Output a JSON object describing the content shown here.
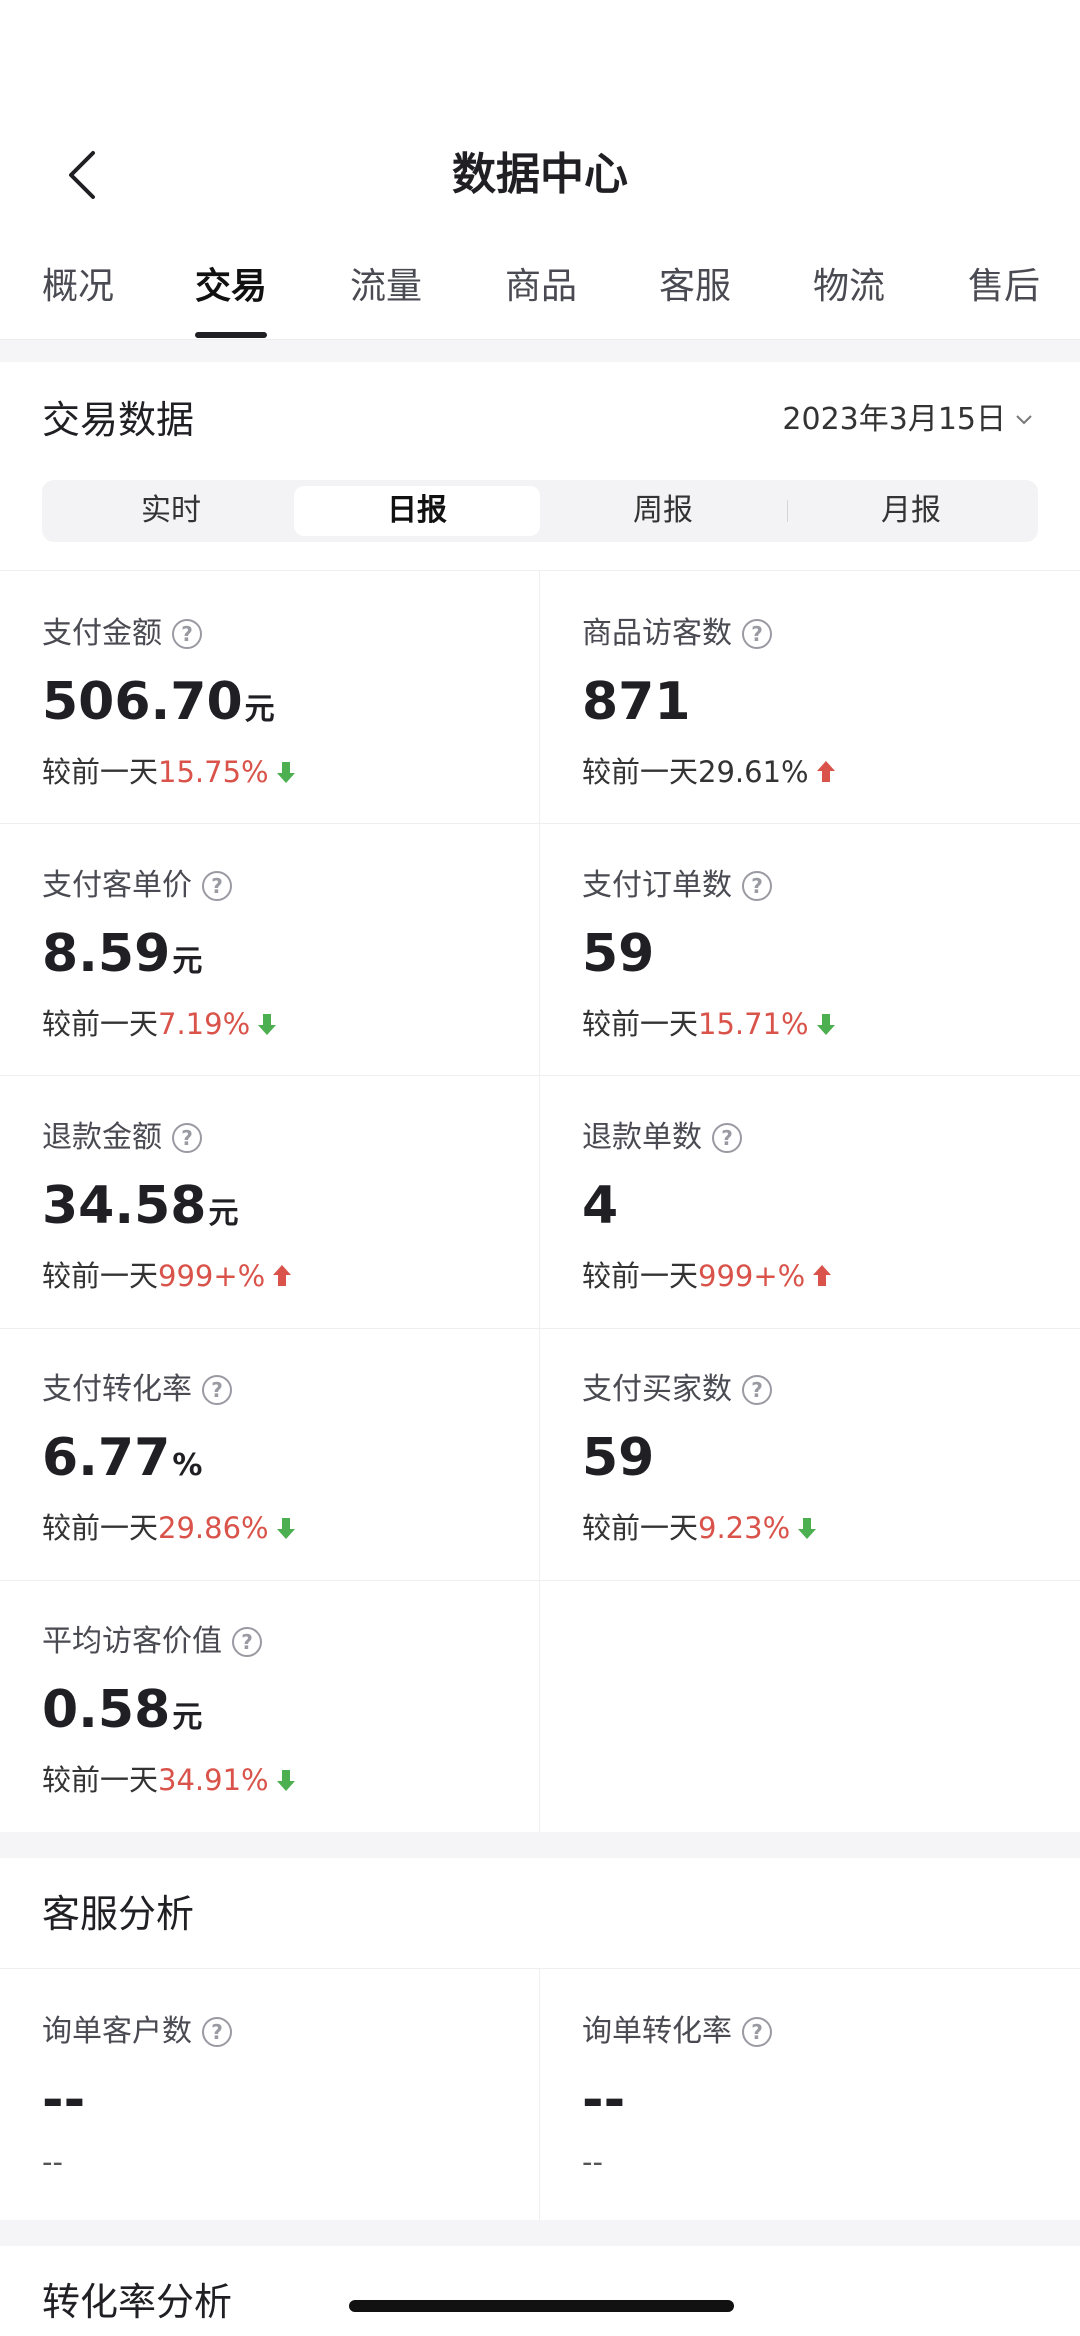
{
  "header": {
    "title": "数据中心",
    "back_icon": "chevron-left-icon"
  },
  "tabs": [
    {
      "label": "概况",
      "active": false
    },
    {
      "label": "交易",
      "active": true
    },
    {
      "label": "流量",
      "active": false
    },
    {
      "label": "商品",
      "active": false
    },
    {
      "label": "客服",
      "active": false
    },
    {
      "label": "物流",
      "active": false
    },
    {
      "label": "售后",
      "active": false
    }
  ],
  "trade": {
    "title": "交易数据",
    "date": "2023年3月15日",
    "periods": [
      {
        "label": "实时",
        "active": false
      },
      {
        "label": "日报",
        "active": true
      },
      {
        "label": "周报",
        "active": false
      },
      {
        "label": "月报",
        "active": false
      }
    ],
    "compare_prefix": "较前一天",
    "metrics": [
      {
        "label": "支付金额",
        "value": "506.70",
        "unit": "元",
        "change": "15.75%",
        "direction": "down"
      },
      {
        "label": "商品访客数",
        "value": "871",
        "unit": "",
        "change": "29.61%",
        "direction": "up"
      },
      {
        "label": "支付客单价",
        "value": "8.59",
        "unit": "元",
        "change": "7.19%",
        "direction": "down"
      },
      {
        "label": "支付订单数",
        "value": "59",
        "unit": "",
        "change": "15.71%",
        "direction": "down"
      },
      {
        "label": "退款金额",
        "value": "34.58",
        "unit": "元",
        "change": "999+%",
        "direction": "up"
      },
      {
        "label": "退款单数",
        "value": "4",
        "unit": "",
        "change": "999+%",
        "direction": "up"
      },
      {
        "label": "支付转化率",
        "value": "6.77",
        "unit": "%",
        "change": "29.86%",
        "direction": "down"
      },
      {
        "label": "支付买家数",
        "value": "59",
        "unit": "",
        "change": "9.23%",
        "direction": "down"
      },
      {
        "label": "平均访客价值",
        "value": "0.58",
        "unit": "元",
        "change": "34.91%",
        "direction": "down"
      }
    ]
  },
  "service": {
    "title": "客服分析",
    "metrics": [
      {
        "label": "询单客户数",
        "value": "--",
        "compare": "--"
      },
      {
        "label": "询单转化率",
        "value": "--",
        "compare": "--"
      }
    ]
  },
  "conversion": {
    "title": "转化率分析"
  },
  "colors": {
    "up": "#d9534a",
    "down": "#4caf50",
    "accent_dot": "#f2b24f"
  }
}
